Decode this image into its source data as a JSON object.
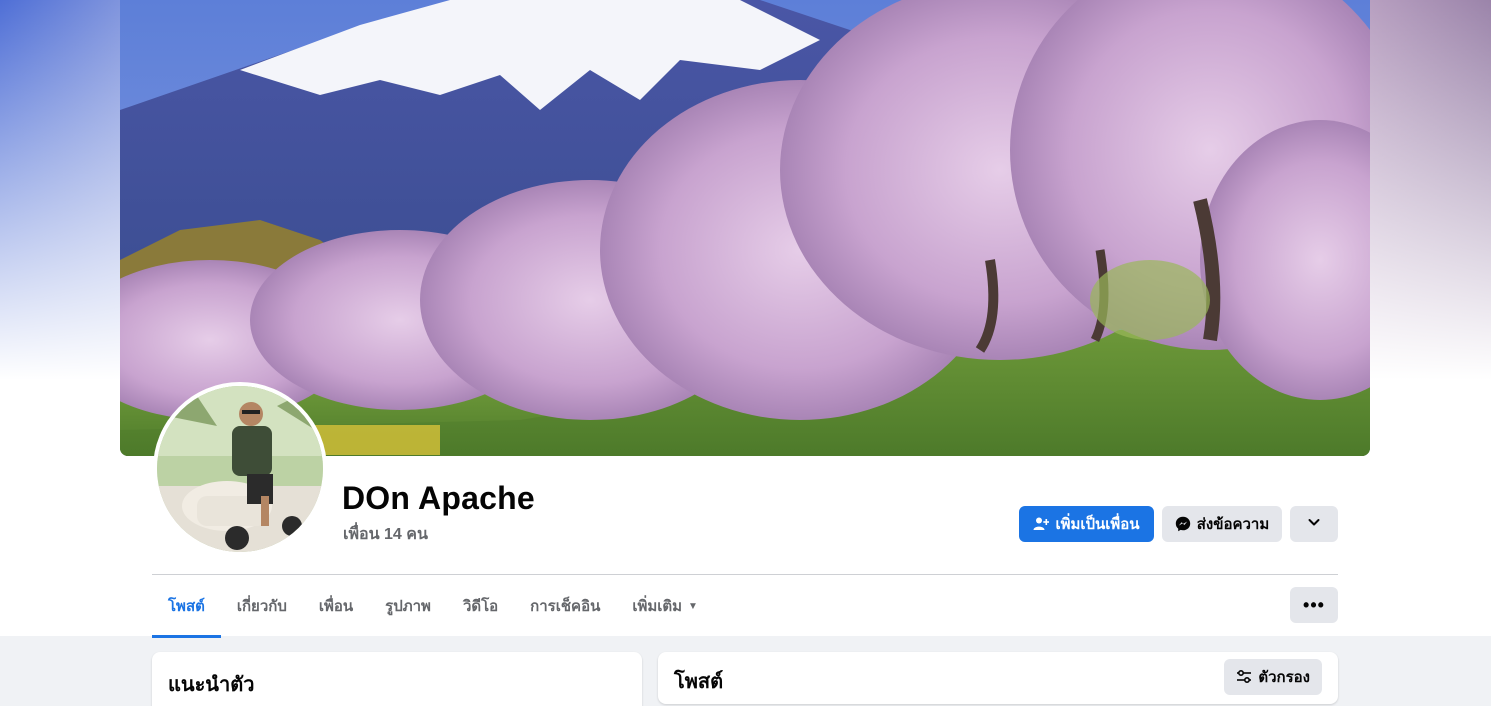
{
  "profile": {
    "name": "DOn Apache",
    "friends_count": "เพื่อน 14 คน"
  },
  "actions": {
    "add_friend_label": "เพิ่มเป็นเพื่อน",
    "message_label": "ส่งข้อความ"
  },
  "tabs": [
    {
      "label": "โพสต์",
      "active": true
    },
    {
      "label": "เกี่ยวกับ"
    },
    {
      "label": "เพื่อน"
    },
    {
      "label": "รูปภาพ"
    },
    {
      "label": "วิดีโอ"
    },
    {
      "label": "การเช็คอิน"
    },
    {
      "label": "เพิ่มเติม"
    }
  ],
  "more_button_label": "•••",
  "intro": {
    "title": "แนะนำตัว"
  },
  "posts": {
    "title": "โพสต์",
    "filter_label": "ตัวกรอง"
  },
  "colors": {
    "accent": "#1b74e4",
    "secondary_button": "#e4e6eb",
    "page_background": "#f0f2f5"
  },
  "icons": {
    "add_friend": "person-plus-icon",
    "message": "messenger-icon",
    "dropdown": "chevron-down-icon",
    "more": "ellipsis-icon",
    "filter": "sliders-icon"
  }
}
